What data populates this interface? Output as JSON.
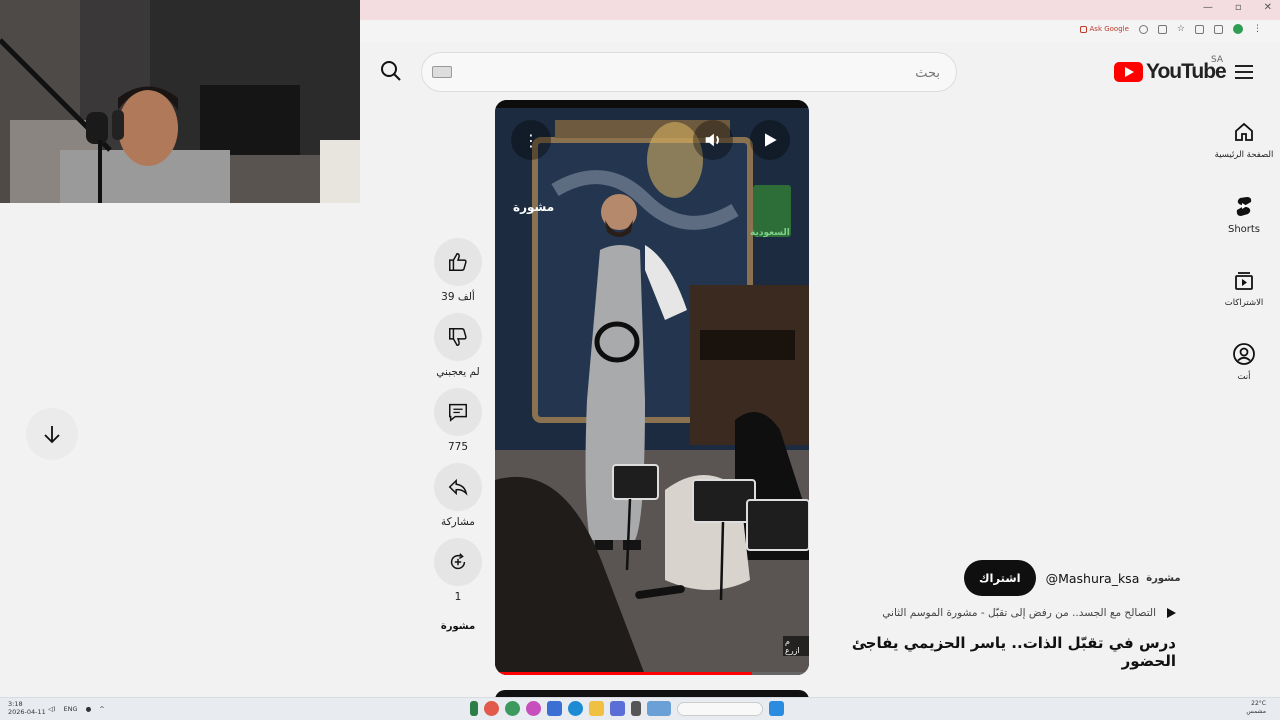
{
  "browser": {
    "ask_google_label": "Ask Google",
    "window_controls": [
      "—",
      "▫",
      "✕"
    ]
  },
  "header": {
    "search_placeholder": "بحث",
    "logo_text": "YouTube",
    "logo_country": "SA"
  },
  "sidebar": {
    "items": [
      {
        "label": "الصفحة الرئيسية",
        "icon": "home-icon"
      },
      {
        "label": "Shorts",
        "icon": "shorts-icon"
      },
      {
        "label": "الاشتراكات",
        "icon": "subscriptions-icon"
      },
      {
        "label": "أنت",
        "icon": "you-icon"
      }
    ]
  },
  "actions": {
    "like_count": "39 ألف",
    "dislike_label": "لم يعجبني",
    "comment_count": "775",
    "share_label": "مشاركة",
    "remix_count": "1"
  },
  "video": {
    "progress": 0.82,
    "overlay_watermark": "مشورة",
    "overlay_logo": "السعودية",
    "corner_text": "م ازرع"
  },
  "channel": {
    "subscribe_label": "اشتراك",
    "handle": "@Mashura_ksa",
    "avatar_text": "مشورة"
  },
  "short": {
    "sound_label": "التصالح مع الجسد.. من رفض إلى تقبّل - مشورة الموسم الثاني",
    "title": "درس في تقبّل الذات.. ياسر الحزيمي يفاجئ الحضور"
  },
  "taskbar": {
    "time": "3:18",
    "date": "2026-04-11",
    "lang": "ENG",
    "weather": "22°C",
    "weather_desc": "مشمس"
  },
  "colors": {
    "brand_red": "#ff0000",
    "subscribe_bg": "#0f0f0f"
  }
}
